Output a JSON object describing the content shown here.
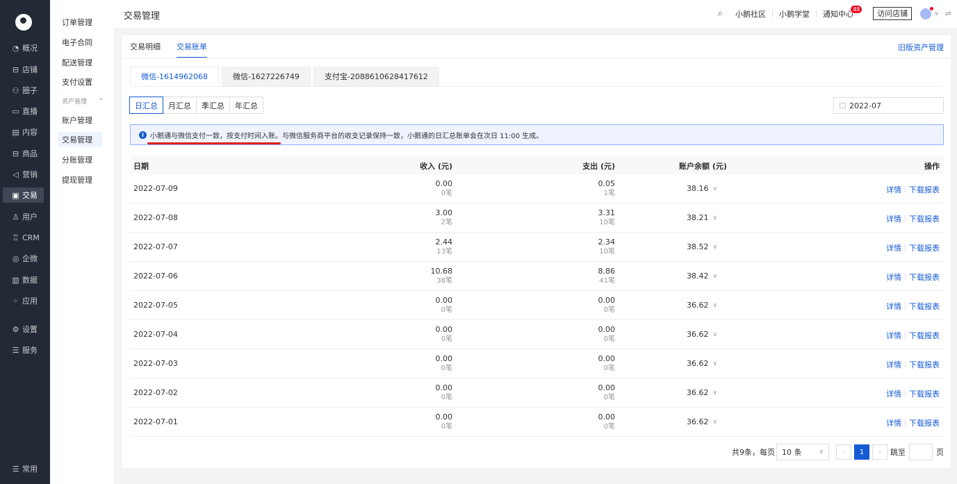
{
  "sidebar": {
    "items": [
      {
        "icon": "◔",
        "label": "概况"
      },
      {
        "icon": "⊟",
        "label": "店铺"
      },
      {
        "icon": "⚇",
        "label": "圈子"
      },
      {
        "icon": "▭",
        "label": "直播"
      },
      {
        "icon": "▤",
        "label": "内容"
      },
      {
        "icon": "⊟",
        "label": "商品"
      },
      {
        "icon": "◁",
        "label": "营销"
      },
      {
        "icon": "▣",
        "label": "交易"
      },
      {
        "icon": "♙",
        "label": "用户"
      },
      {
        "icon": "♖",
        "label": "CRM"
      },
      {
        "icon": "◎",
        "label": "企微"
      },
      {
        "icon": "▥",
        "label": "数据"
      },
      {
        "icon": "⁘",
        "label": "应用"
      },
      {
        "icon": "⚙",
        "label": "设置"
      },
      {
        "icon": "☰",
        "label": "服务"
      }
    ],
    "common": {
      "icon": "☰",
      "label": "常用"
    }
  },
  "subnav": {
    "items": [
      "订单管理",
      "电子合同",
      "配送管理",
      "支付设置"
    ],
    "group_label": "资产管理",
    "group_items": [
      "账户管理",
      "交易管理",
      "分账管理",
      "提现管理"
    ]
  },
  "header": {
    "title": "交易管理",
    "links": [
      "小鹅社区",
      "小鹅学堂",
      "通知中心"
    ],
    "notice_count": "48",
    "visit_store": "访问店铺"
  },
  "tabs": [
    "交易明细",
    "交易账单"
  ],
  "old_assets_link": "旧版资产管理",
  "accounts": [
    "微信-1614962068",
    "微信-1627226749",
    "支付宝-2088610628417612"
  ],
  "periods": [
    "日汇总",
    "月汇总",
    "季汇总",
    "年汇总"
  ],
  "date_value": "2022-07",
  "notice": "小鹅通与微信支付一致，按支付时间入账。与微信服务商平台的收支记录保持一致，小鹅通的日汇总账单会在次日 11:00 生成。",
  "table": {
    "headers": {
      "date": "日期",
      "income": "收入 (元)",
      "expense": "支出 (元)",
      "balance": "账户余额 (元)",
      "ops": "操作"
    },
    "rows": [
      {
        "date": "2022-07-09",
        "income": "0.00",
        "income_count": "0笔",
        "expense": "0.05",
        "expense_count": "1笔",
        "balance": "38.16"
      },
      {
        "date": "2022-07-08",
        "income": "3.00",
        "income_count": "2笔",
        "expense": "3.31",
        "expense_count": "10笔",
        "balance": "38.21"
      },
      {
        "date": "2022-07-07",
        "income": "2.44",
        "income_count": "13笔",
        "expense": "2.34",
        "expense_count": "10笔",
        "balance": "38.52"
      },
      {
        "date": "2022-07-06",
        "income": "10.68",
        "income_count": "38笔",
        "expense": "8.86",
        "expense_count": "41笔",
        "balance": "38.42"
      },
      {
        "date": "2022-07-05",
        "income": "0.00",
        "income_count": "0笔",
        "expense": "0.00",
        "expense_count": "0笔",
        "balance": "36.62"
      },
      {
        "date": "2022-07-04",
        "income": "0.00",
        "income_count": "0笔",
        "expense": "0.00",
        "expense_count": "0笔",
        "balance": "36.62"
      },
      {
        "date": "2022-07-03",
        "income": "0.00",
        "income_count": "0笔",
        "expense": "0.00",
        "expense_count": "0笔",
        "balance": "36.62"
      },
      {
        "date": "2022-07-02",
        "income": "0.00",
        "income_count": "0笔",
        "expense": "0.00",
        "expense_count": "0笔",
        "balance": "36.62"
      },
      {
        "date": "2022-07-01",
        "income": "0.00",
        "income_count": "0笔",
        "expense": "0.00",
        "expense_count": "0笔",
        "balance": "36.62"
      }
    ],
    "op_detail": "详情",
    "op_download": "下载报表"
  },
  "pagination": {
    "summary": "共9条，每页",
    "page_size": "10 条",
    "current_page": "1",
    "jump_label": "跳至",
    "page_suffix": "页"
  },
  "colors": {
    "accent": "#155bd4",
    "sidebar_bg": "#232a36",
    "mark": "#e02020"
  }
}
